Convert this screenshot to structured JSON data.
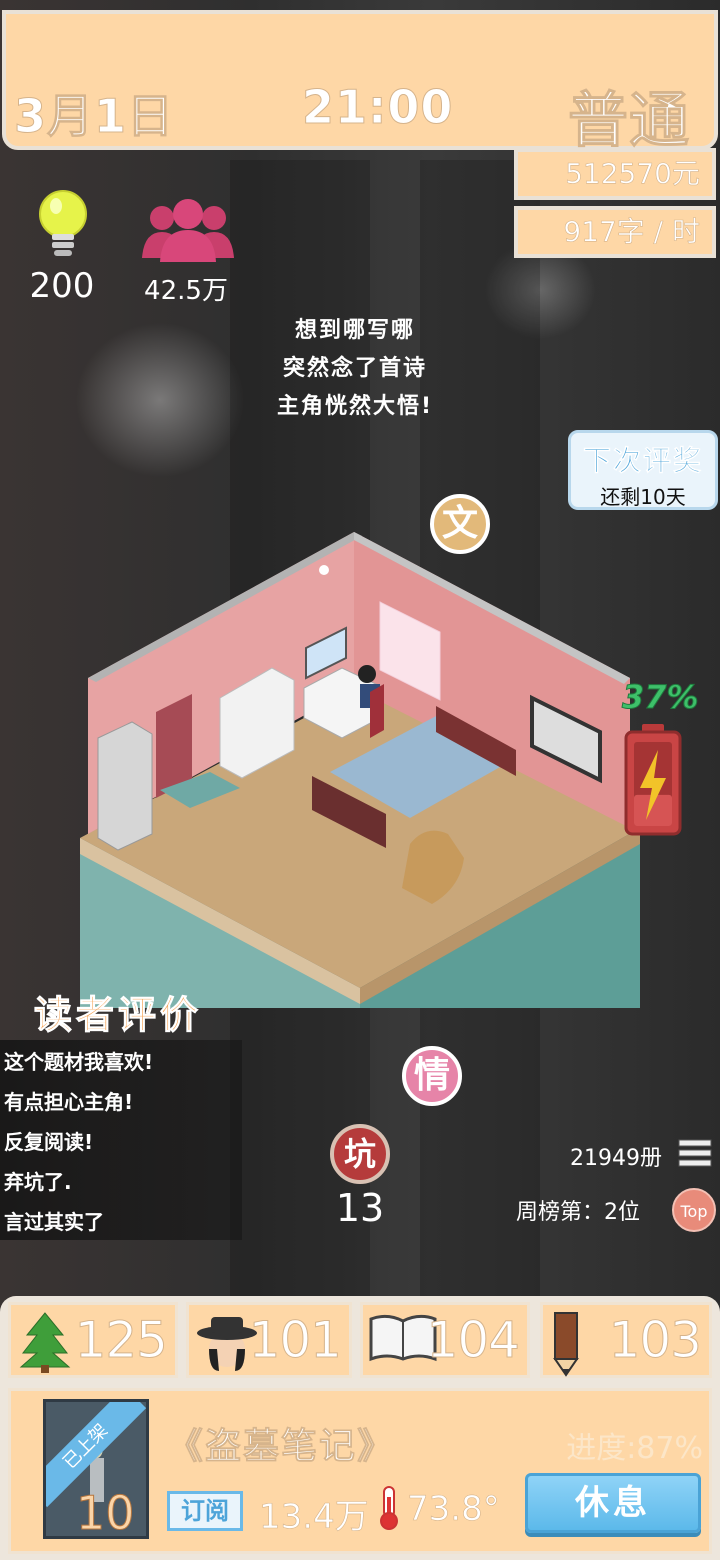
{
  "header": {
    "date": "3月1日",
    "time": "21:00",
    "mode": "普通",
    "money": "512570元",
    "speed": "917字 / 时"
  },
  "stats": {
    "ideas": "200",
    "fans": "42.5万"
  },
  "story_lines": [
    "想到哪写哪",
    "突然念了首诗",
    "主角恍然大悟!"
  ],
  "award": {
    "title": "下次评奖",
    "remaining": "还剩10天"
  },
  "bubbles": {
    "wen": "文",
    "qing": "情",
    "keng": "坑"
  },
  "keng_count": "13",
  "battery": {
    "percent": "37%",
    "level": 0.37
  },
  "reviews": {
    "title": "读者评价",
    "items": [
      "这个题材我喜欢!",
      "有点担心主角!",
      "反复阅读!",
      "弃坑了.",
      "言过其实了"
    ]
  },
  "sales": {
    "books": "21949册",
    "rank": "周榜第：2位",
    "top_badge": "Top"
  },
  "attributes": [
    {
      "icon": "tree-icon",
      "value": "125"
    },
    {
      "icon": "hat-character-icon",
      "value": "101"
    },
    {
      "icon": "open-book-icon",
      "value": "104"
    },
    {
      "icon": "pencil-icon",
      "value": "103"
    }
  ],
  "book": {
    "status": "已上架",
    "cover_number": "10",
    "title": "《盗墓笔记》",
    "progress": "进度:87%",
    "subscribe_label": "订阅",
    "subscribers": "13.4万",
    "heat": "73.8°",
    "rest_label": "休息"
  },
  "colors": {
    "panel": "#fed7a6",
    "accent_blue": "#6ab9e8",
    "review_title": "#f5a050",
    "battery_green": "#3ec06a"
  }
}
